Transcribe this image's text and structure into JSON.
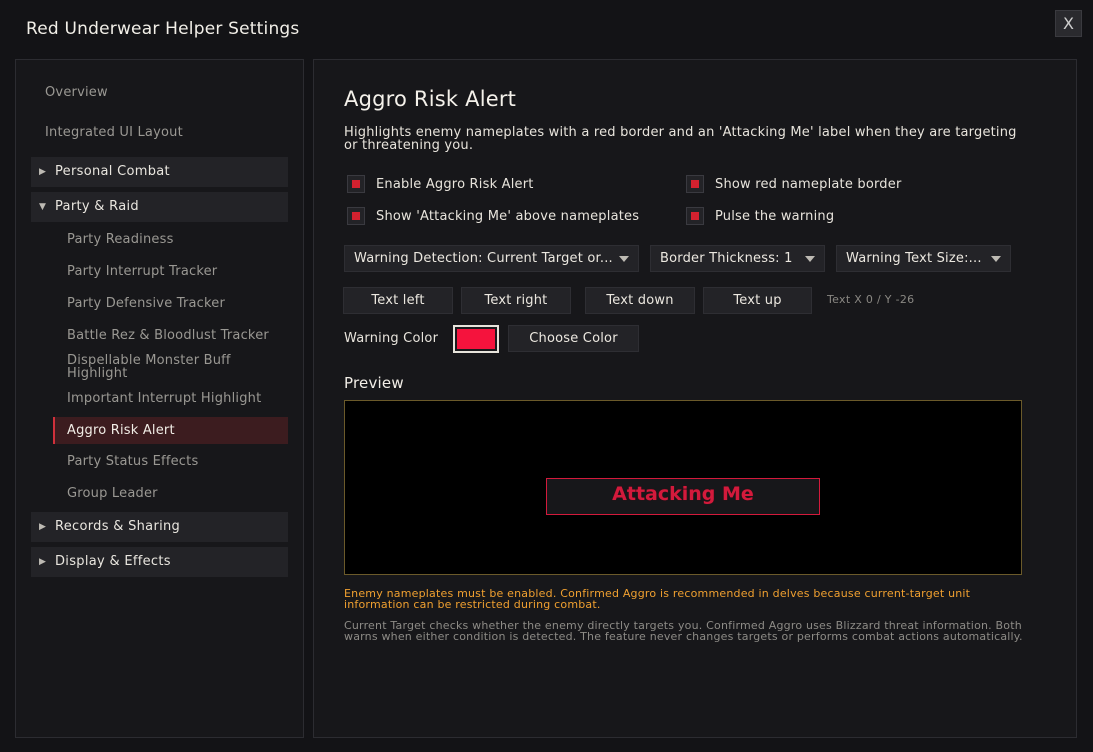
{
  "window": {
    "title": "Red Underwear Helper Settings",
    "close_label": "X"
  },
  "sidebar": {
    "top_items": [
      "Overview",
      "Integrated UI Layout"
    ],
    "groups": [
      {
        "label": "Personal Combat",
        "expanded": false
      },
      {
        "label": "Party & Raid",
        "expanded": true
      },
      {
        "label": "Records & Sharing",
        "expanded": false
      },
      {
        "label": "Display & Effects",
        "expanded": false
      }
    ],
    "party_raid_items": [
      "Party Readiness",
      "Party Interrupt Tracker",
      "Party Defensive Tracker",
      "Battle Rez & Bloodlust Tracker",
      "Dispellable Monster Buff Highlight",
      "Important Interrupt Highlight",
      "Aggro Risk Alert",
      "Party Status Effects",
      "Group Leader"
    ],
    "active_item": "Aggro Risk Alert"
  },
  "main": {
    "title": "Aggro Risk Alert",
    "description": "Highlights enemy nameplates with a red border and an 'Attacking Me' label when they are targeting or threatening you.",
    "checkboxes": [
      {
        "label": "Enable Aggro Risk Alert",
        "checked": true
      },
      {
        "label": "Show red nameplate border",
        "checked": true
      },
      {
        "label": "Show 'Attacking Me' above nameplates",
        "checked": true
      },
      {
        "label": "Pulse the warning",
        "checked": true
      }
    ],
    "dropdowns": [
      {
        "label": "Warning Detection: Current Target or..."
      },
      {
        "label": "Border Thickness: 1"
      },
      {
        "label": "Warning Text Size:..."
      }
    ],
    "buttons": [
      "Text left",
      "Text right",
      "Text down",
      "Text up"
    ],
    "offset_label": "Text X 0 / Y -26",
    "warning_color_label": "Warning Color",
    "warning_color": "#f5133d",
    "choose_color_label": "Choose Color",
    "preview_title": "Preview",
    "preview_text": "Attacking Me",
    "warning_note": "Enemy nameplates must be enabled. Confirmed Aggro is recommended in delves because current-target unit information can be restricted during combat.",
    "info_note": "Current Target checks whether the enemy directly targets you. Confirmed Aggro uses Blizzard threat information. Both warns when either condition is detected. The feature never changes targets or performs combat actions automatically."
  },
  "colors": {
    "accent_red": "#d3212f",
    "warning_orange": "#f0a030",
    "preview_border": "#6b5a2a"
  }
}
